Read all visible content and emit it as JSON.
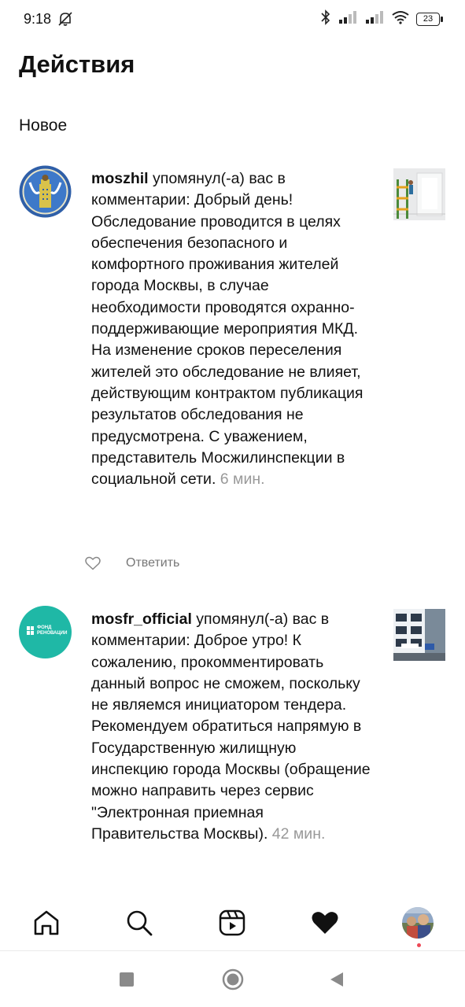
{
  "status_bar": {
    "time": "9:18",
    "battery": "23",
    "icons": [
      "do-not-disturb-icon",
      "bluetooth-icon",
      "signal-icon",
      "signal-icon",
      "wifi-icon",
      "battery-icon"
    ]
  },
  "header": {
    "title": "Действия"
  },
  "section": {
    "title": "Новое"
  },
  "notifications": [
    {
      "username": "moszhil",
      "action": " упомянул(-а) вас в комментарии: ",
      "comment": "Добрый день! Обследование проводится в целях обеспечения безопасного и комфортного проживания жителей города Москвы, в случае необходимости проводятся охранно-поддерживающие мероприятия МКД. На изменение сроков переселения жителей это обследование не влияет, действующим контрактом публикация результатов обследования не предусмотрена. С уважением, представитель Мосжилинспекции в социальной сети.",
      "time": "6 мин.",
      "reply_label": "Ответить"
    },
    {
      "username": "mosfr_official",
      "action": " упомянул(-а) вас в комментарии: ",
      "comment": "Доброе утро! К сожалению, прокомментировать данный вопрос не сможем, поскольку не являемся инициатором тендера. Рекомендуем обратиться напрямую в Государственную жилищную инспекцию города Москвы (обращение можно направить через сервис \"Электронная приемная Правительства Москвы).",
      "time": "42 мин.",
      "avatar_text": "ФОНД РЕНОВАЦИИ"
    }
  ],
  "bottom_nav": {
    "items": [
      "home-icon",
      "search-icon",
      "reels-icon",
      "heart-icon",
      "profile-avatar"
    ]
  },
  "system_nav": {
    "items": [
      "recents-button",
      "home-button",
      "back-button"
    ]
  },
  "colors": {
    "accent_green": "#1fb8a6",
    "notification_dot": "#ed4956",
    "muted": "#999999"
  }
}
